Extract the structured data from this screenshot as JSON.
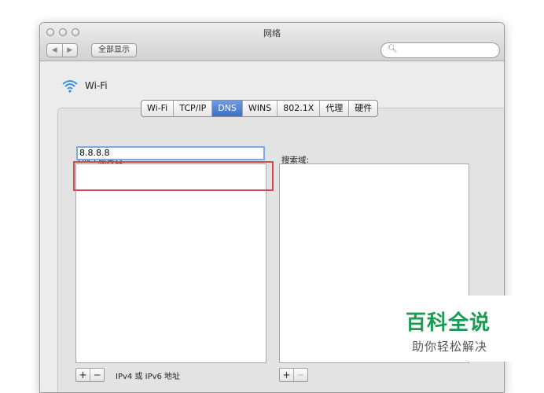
{
  "window": {
    "title": "网络",
    "nav_back": "◀",
    "nav_forward": "▶",
    "show_all_label": "全部显示",
    "search_placeholder": ""
  },
  "interface": {
    "icon": "wifi-icon",
    "name": "Wi-Fi"
  },
  "tabs": [
    {
      "label": "Wi-Fi",
      "active": false
    },
    {
      "label": "TCP/IP",
      "active": false
    },
    {
      "label": "DNS",
      "active": true
    },
    {
      "label": "WINS",
      "active": false
    },
    {
      "label": "802.1X",
      "active": false
    },
    {
      "label": "代理",
      "active": false
    },
    {
      "label": "硬件",
      "active": false
    }
  ],
  "dns": {
    "label": "DNS 服务器:",
    "servers": [
      "8.8.8.8"
    ],
    "add_label": "+",
    "remove_label": "−",
    "note": "IPv4 或 IPv6 地址"
  },
  "search_domains": {
    "label": "搜索域:",
    "add_label": "+",
    "remove_label": "−"
  },
  "watermark": {
    "title": "百科全说",
    "subtitle": "助你轻松解决"
  },
  "colors": {
    "accent": "#3b6fca",
    "highlight_box": "#d44a4a",
    "watermark_green": "#1b9a52"
  }
}
